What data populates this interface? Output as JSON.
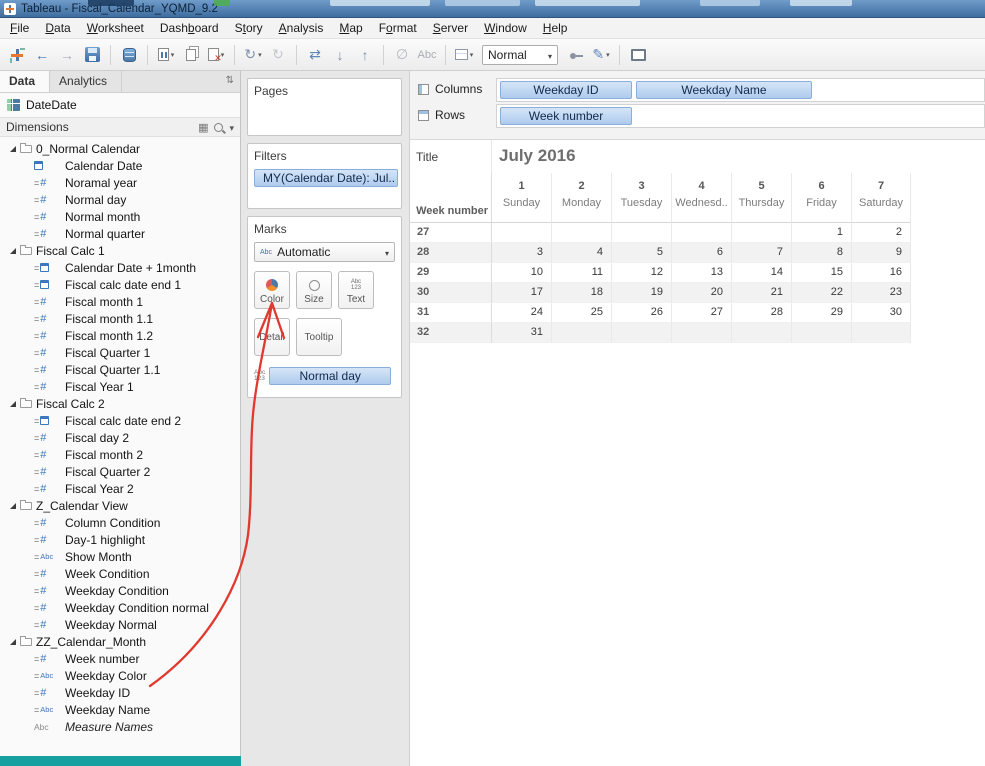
{
  "window": {
    "title": "Tableau - Fiscal_Calendar_YQMD_9.2"
  },
  "menubar": {
    "items": [
      {
        "label": "File",
        "underline": 0
      },
      {
        "label": "Data",
        "underline": 0
      },
      {
        "label": "Worksheet",
        "underline": 0
      },
      {
        "label": "Dashboard",
        "underline": 4
      },
      {
        "label": "Story",
        "underline": 1
      },
      {
        "label": "Analysis",
        "underline": 0
      },
      {
        "label": "Map",
        "underline": 0
      },
      {
        "label": "Format",
        "underline": 1
      },
      {
        "label": "Server",
        "underline": 0
      },
      {
        "label": "Window",
        "underline": 0
      },
      {
        "label": "Help",
        "underline": 0
      }
    ]
  },
  "toolbar": {
    "fit_value": "Normal",
    "labels_button": "Abc"
  },
  "icon_glyphs": {
    "number": "#",
    "string": "Abc",
    "calc": "="
  },
  "data_pane": {
    "tab_data": "Data",
    "tab_analytics": "Analytics",
    "datasource": "DateDate",
    "dimensions_label": "Dimensions",
    "tree": [
      {
        "kind": "folder",
        "label": "0_Normal Calendar"
      },
      {
        "kind": "date",
        "label": "Calendar Date"
      },
      {
        "kind": "number",
        "calc": true,
        "label": "Noramal year"
      },
      {
        "kind": "number",
        "calc": true,
        "label": "Normal day"
      },
      {
        "kind": "number",
        "calc": true,
        "label": "Normal month"
      },
      {
        "kind": "number",
        "calc": true,
        "label": "Normal quarter"
      },
      {
        "kind": "folder",
        "label": "Fiscal Calc 1"
      },
      {
        "kind": "date",
        "calc": true,
        "label": "Calendar Date + 1month"
      },
      {
        "kind": "date",
        "calc": true,
        "label": "Fiscal calc date end 1"
      },
      {
        "kind": "number",
        "calc": true,
        "label": "Fiscal month 1"
      },
      {
        "kind": "number",
        "calc": true,
        "label": "Fiscal month 1.1"
      },
      {
        "kind": "number",
        "calc": true,
        "label": "Fiscal month 1.2"
      },
      {
        "kind": "number",
        "calc": true,
        "label": "Fiscal Quarter 1"
      },
      {
        "kind": "number",
        "calc": true,
        "label": "Fiscal Quarter 1.1"
      },
      {
        "kind": "number",
        "calc": true,
        "label": "Fiscal Year 1"
      },
      {
        "kind": "folder",
        "label": "Fiscal Calc 2"
      },
      {
        "kind": "date",
        "calc": true,
        "label": "Fiscal calc date end 2"
      },
      {
        "kind": "number",
        "calc": true,
        "label": "Fiscal day 2"
      },
      {
        "kind": "number",
        "calc": true,
        "label": "Fiscal month 2"
      },
      {
        "kind": "number",
        "calc": true,
        "label": "Fiscal Quarter 2"
      },
      {
        "kind": "number",
        "calc": true,
        "label": "Fiscal Year 2"
      },
      {
        "kind": "folder",
        "label": "Z_Calendar View"
      },
      {
        "kind": "number",
        "calc": true,
        "label": "Column Condition"
      },
      {
        "kind": "number",
        "calc": true,
        "label": "Day-1 highlight"
      },
      {
        "kind": "string",
        "calc": true,
        "label": "Show Month"
      },
      {
        "kind": "number",
        "calc": true,
        "label": "Week Condition"
      },
      {
        "kind": "number",
        "calc": true,
        "label": "Weekday Condition"
      },
      {
        "kind": "number",
        "calc": true,
        "label": "Weekday Condition normal"
      },
      {
        "kind": "number",
        "calc": true,
        "label": "Weekday Normal"
      },
      {
        "kind": "folder",
        "label": "ZZ_Calendar_Month"
      },
      {
        "kind": "number",
        "calc": true,
        "label": "Week number"
      },
      {
        "kind": "string",
        "calc": true,
        "label": "Weekday Color"
      },
      {
        "kind": "number",
        "calc": true,
        "label": "Weekday ID"
      },
      {
        "kind": "string",
        "calc": true,
        "label": "Weekday Name"
      },
      {
        "kind": "string",
        "label": "Measure Names",
        "italic": true,
        "gray": true
      }
    ]
  },
  "cards": {
    "pages": {
      "title": "Pages"
    },
    "filters": {
      "title": "Filters",
      "pill": "MY(Calendar Date): Jul.."
    },
    "marks": {
      "title": "Marks",
      "mark_type": "Automatic",
      "buttons": {
        "color": "Color",
        "size": "Size",
        "text": "Text",
        "detail": "Detail",
        "tooltip": "Tooltip"
      },
      "pill": {
        "label": "Normal day"
      }
    }
  },
  "shelves": {
    "columns": {
      "label": "Columns",
      "pills": [
        "Weekday ID",
        "Weekday Name"
      ]
    },
    "rows": {
      "label": "Rows",
      "pills": [
        "Week number"
      ]
    }
  },
  "sheet": {
    "title_gutter": "Title",
    "title": "July 2016"
  },
  "chart_data": {
    "type": "table",
    "title": "July 2016",
    "row_header": "Week number",
    "columns": [
      {
        "id": "1",
        "name": "Sunday"
      },
      {
        "id": "2",
        "name": "Monday"
      },
      {
        "id": "3",
        "name": "Tuesday"
      },
      {
        "id": "4",
        "name": "Wednesd.."
      },
      {
        "id": "5",
        "name": "Thursday"
      },
      {
        "id": "6",
        "name": "Friday"
      },
      {
        "id": "7",
        "name": "Saturday"
      }
    ],
    "rows": [
      {
        "week": "27",
        "values": [
          "",
          "",
          "",
          "",
          "",
          "1",
          "2"
        ]
      },
      {
        "week": "28",
        "values": [
          "3",
          "4",
          "5",
          "6",
          "7",
          "8",
          "9"
        ]
      },
      {
        "week": "29",
        "values": [
          "10",
          "11",
          "12",
          "13",
          "14",
          "15",
          "16"
        ]
      },
      {
        "week": "30",
        "values": [
          "17",
          "18",
          "19",
          "20",
          "21",
          "22",
          "23"
        ]
      },
      {
        "week": "31",
        "values": [
          "24",
          "25",
          "26",
          "27",
          "28",
          "29",
          "30"
        ]
      },
      {
        "week": "32",
        "values": [
          "31",
          "",
          "",
          "",
          "",
          "",
          ""
        ]
      }
    ]
  }
}
